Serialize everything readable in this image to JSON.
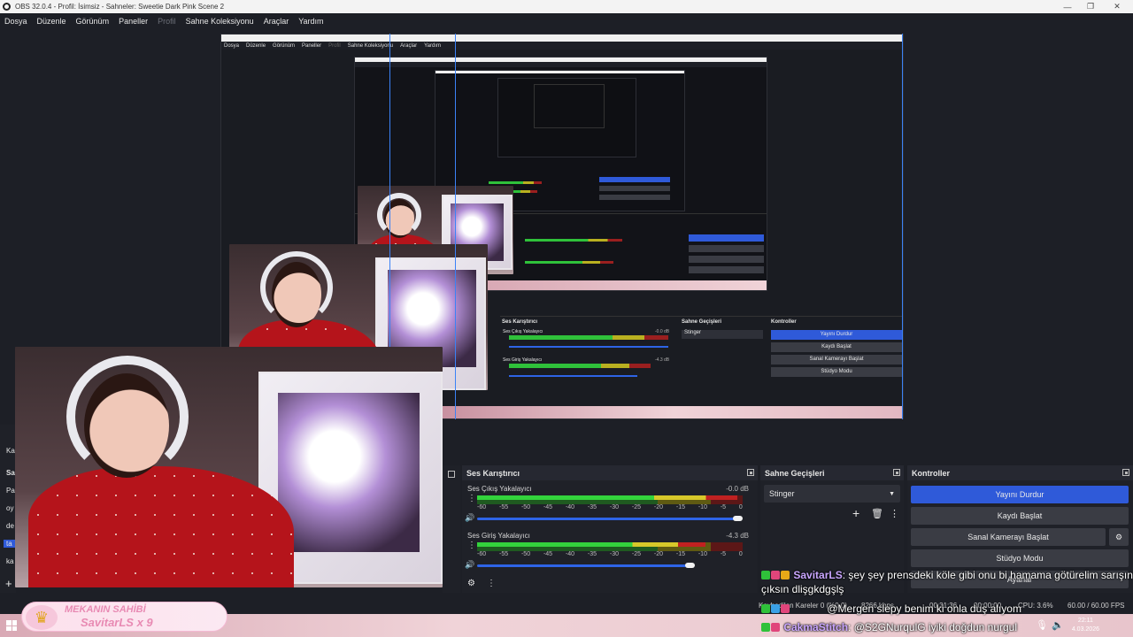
{
  "window": {
    "title": "OBS 32.0.4 - Profil: İsimsiz - Sahneler: Sweetie Dark Pink Scene 2",
    "minimize_glyph": "—",
    "maximize_glyph": "❐",
    "close_glyph": "✕"
  },
  "menu": {
    "items": [
      "Dosya",
      "Düzenle",
      "Görünüm",
      "Paneller",
      "Profil",
      "Sahne Koleksiyonu",
      "Araçlar",
      "Yardım"
    ]
  },
  "nested_menu": {
    "items": [
      "Dosya",
      "Düzenle",
      "Görünüm",
      "Paneller",
      "Profil",
      "Sahne Koleksiyonu",
      "Araçlar",
      "Yardım"
    ]
  },
  "nested_docks": {
    "mixer_title": "Ses Karıştırıcı",
    "transitions_title": "Sahne Geçişleri",
    "controls_title": "Kontroller",
    "desktop_audio": "Ses Çıkış Yakalayıcı",
    "mic_audio": "Ses Giriş Yakalayıcı",
    "desktop_db": "-0.0 dB",
    "mic_db": "-4.3 dB",
    "transition": "Stinger",
    "btn_stop": "Yayını Durdur",
    "btn_record": "Kaydı Başlat",
    "btn_vcam": "Sanal Kamerayı Başlat",
    "btn_studio": "Stüdyo Modu"
  },
  "mixer": {
    "title": "Ses Karıştırıcı",
    "channels": [
      {
        "name": "Ses Çıkış Yakalayıcı",
        "db": "-0.0 dB",
        "level": 0.98,
        "volume": 0.98
      },
      {
        "name": "Ses Giriş Yakalayıcı",
        "db": "-4.3 dB",
        "level": 0.86,
        "volume": 0.8
      }
    ],
    "ticks": [
      "-60",
      "-55",
      "-50",
      "-45",
      "-40",
      "-35",
      "-30",
      "-25",
      "-20",
      "-15",
      "-10",
      "-5",
      "0"
    ]
  },
  "transitions": {
    "title": "Sahne Geçişleri",
    "selected": "Stinger"
  },
  "controls": {
    "title": "Kontroller",
    "stop_stream": "Yayını Durdur",
    "start_record": "Kaydı Başlat",
    "start_vcam": "Sanal Kamerayı Başlat",
    "studio_mode": "Stüdyo Modu",
    "settings": "Ayarlar"
  },
  "left_stub": {
    "items": [
      "Ka",
      "Sa",
      "Pa",
      "oy",
      "de",
      "ta",
      "ka"
    ]
  },
  "status": {
    "dropped": "Kaybedilen Kareler 0 (%0.0)",
    "bitrate": "8266 kbps",
    "stream_time": "00:31:36",
    "rec_time": "00:00:00",
    "cpu": "CPU: 3.6%",
    "fps": "60.00 / 60.00 FPS"
  },
  "chat": [
    {
      "user": "SavitarLS",
      "sep": ": ",
      "text": "şey şey prensdeki köle gibi onu bi hamama götürelim sarışın",
      "cont": "çıksın dlişgkdgşlş",
      "color": "#c9a6ff"
    },
    {
      "user": "",
      "sep": "",
      "text": "@Mergen slepy benim ki onla duş alıyom",
      "color": "#ffffff"
    },
    {
      "user": "CakmaStitch",
      "sep": ": ",
      "text": "@S2GNurqulG iyiki doğdun nurgul",
      "color": "#c9a6ff"
    }
  ],
  "owner_badge": {
    "line1": "MEKANIN SAHİBİ",
    "line2": "SavitarLS x 9"
  },
  "clock": {
    "time": "22:11",
    "date": "4.03.2026"
  }
}
